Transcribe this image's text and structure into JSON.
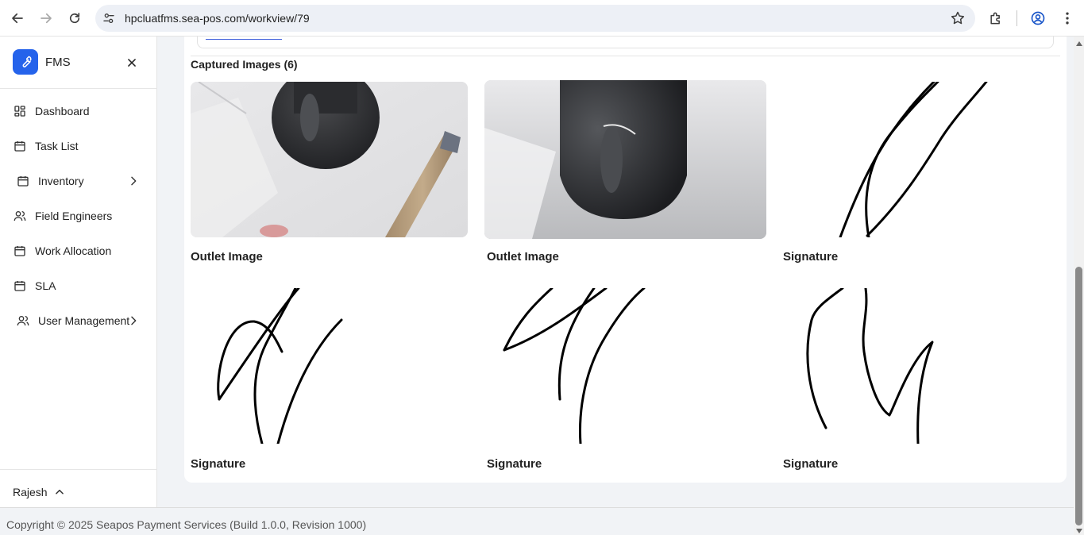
{
  "browser": {
    "url": "hpcluatfms.sea-pos.com/workview/79"
  },
  "sidebar": {
    "brand": "FMS",
    "items": [
      {
        "label": "Dashboard",
        "icon": "grid-icon"
      },
      {
        "label": "Task List",
        "icon": "calendar-icon"
      },
      {
        "label": "Inventory",
        "icon": "calendar-icon",
        "has_submenu": true
      },
      {
        "label": "Field Engineers",
        "icon": "users-icon"
      },
      {
        "label": "Work Allocation",
        "icon": "calendar-icon"
      },
      {
        "label": "SLA",
        "icon": "calendar-icon"
      },
      {
        "label": "User Management",
        "icon": "users-icon",
        "has_submenu": true
      }
    ],
    "user": "Rajesh"
  },
  "main": {
    "section_title": "Captured Images (6)",
    "images": [
      {
        "caption": "Outlet Image",
        "kind": "photo"
      },
      {
        "caption": "Outlet Image",
        "kind": "photo"
      },
      {
        "caption": "Signature",
        "kind": "signature"
      },
      {
        "caption": "Signature",
        "kind": "signature"
      },
      {
        "caption": "Signature",
        "kind": "signature"
      },
      {
        "caption": "Signature",
        "kind": "signature"
      }
    ]
  },
  "footer": {
    "text": "Copyright © 2025 Seapos Payment Services (Build 1.0.0, Revision 1000)"
  },
  "colors": {
    "brand": "#2563eb",
    "page_bg": "#f1f3f6",
    "card_bg": "#ffffff"
  }
}
